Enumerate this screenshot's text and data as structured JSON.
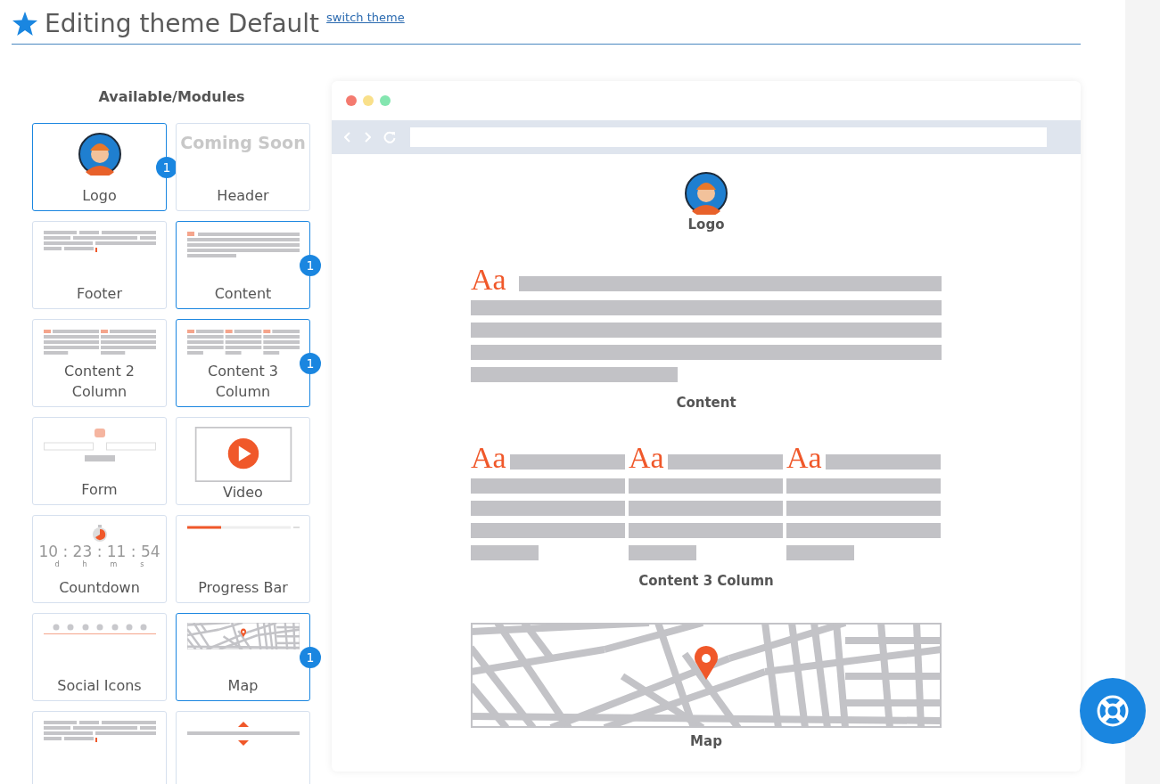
{
  "header": {
    "title": "Editing theme Default",
    "link": "switch theme"
  },
  "modules": {
    "heading": "Available/Modules",
    "items": [
      {
        "label": "Logo",
        "kind": "logo",
        "selected": true,
        "count": "1"
      },
      {
        "label": "Header",
        "kind": "coming-soon",
        "thumb_text": "Coming Soon",
        "selected": false
      },
      {
        "label": "Footer",
        "kind": "footer",
        "selected": false
      },
      {
        "label": "Content",
        "kind": "content",
        "selected": true,
        "count": "1"
      },
      {
        "label": "Content 2 Column",
        "kind": "content2",
        "selected": false
      },
      {
        "label": "Content 3 Column",
        "kind": "content3",
        "selected": true,
        "count": "1"
      },
      {
        "label": "Form",
        "kind": "form",
        "selected": false
      },
      {
        "label": "Video",
        "kind": "video",
        "selected": false
      },
      {
        "label": "Countdown",
        "kind": "countdown",
        "thumb_text": "10 : 23 : 11 : 54",
        "units": [
          "d",
          "h",
          "m",
          "s"
        ],
        "selected": false
      },
      {
        "label": "Progress Bar",
        "kind": "progress",
        "selected": false
      },
      {
        "label": "Social Icons",
        "kind": "social",
        "selected": false
      },
      {
        "label": "Map",
        "kind": "map",
        "selected": true,
        "count": "1"
      },
      {
        "kind": "footer",
        "selected": false
      },
      {
        "kind": "divider",
        "selected": false
      }
    ]
  },
  "preview": {
    "sections": [
      {
        "kind": "logo",
        "caption": "Logo"
      },
      {
        "kind": "content",
        "glyph": "Aa",
        "caption": "Content"
      },
      {
        "kind": "content3",
        "glyphs": [
          "Aa",
          "Aa",
          "Aa"
        ],
        "caption": "Content 3 Column"
      },
      {
        "kind": "map",
        "caption": "Map"
      }
    ]
  }
}
